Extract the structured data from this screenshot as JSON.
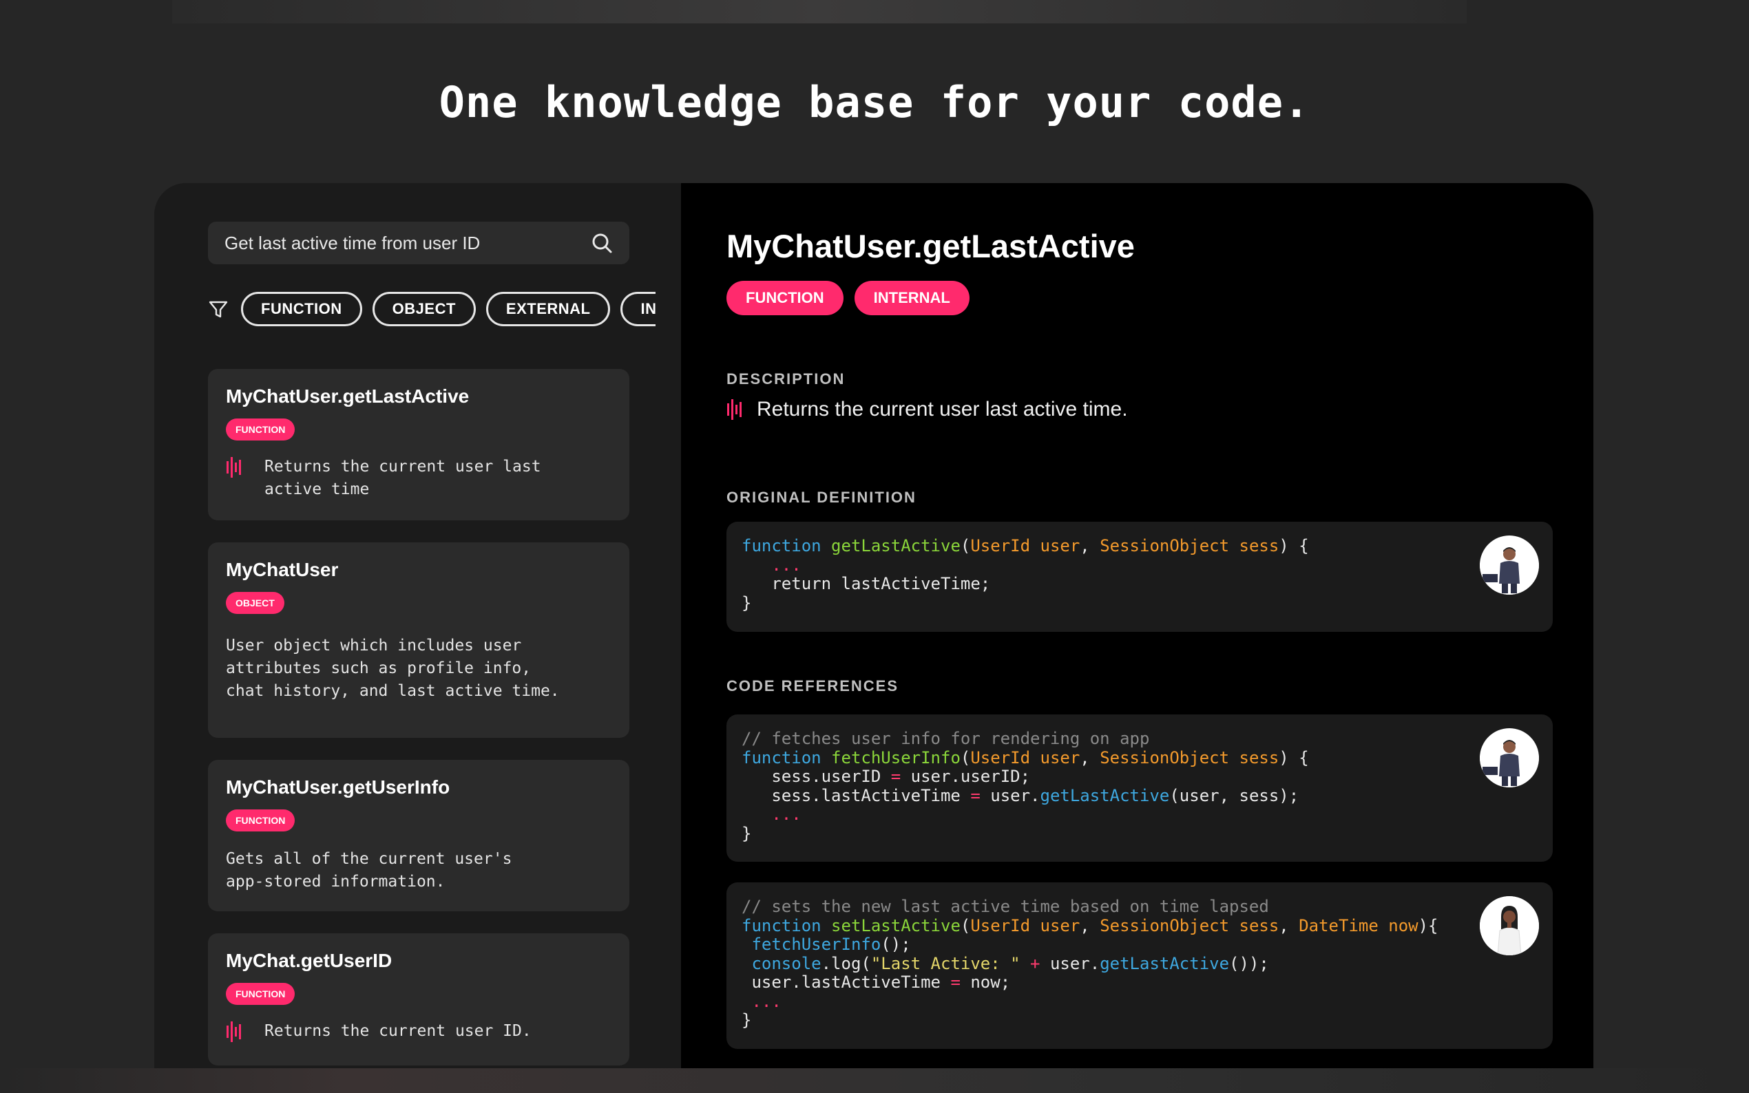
{
  "headline": "One knowledge base for your code.",
  "search": {
    "value": "Get last active time from user ID"
  },
  "filters": [
    "FUNCTION",
    "OBJECT",
    "EXTERNAL",
    "INTERNAL"
  ],
  "results": [
    {
      "title": "MyChatUser.getLastActive",
      "badge": "FUNCTION",
      "desc": "Returns the current user last\nactive time",
      "wave": true
    },
    {
      "title": "MyChatUser",
      "badge": "OBJECT",
      "desc": "User object which includes user\nattributes such as profile info,\nchat history, and last active time.",
      "wave": false
    },
    {
      "title": "MyChatUser.getUserInfo",
      "badge": "FUNCTION",
      "desc": "Gets all of the current user's\napp-stored information.",
      "wave": false
    },
    {
      "title": "MyChat.getUserID",
      "badge": "FUNCTION",
      "desc": "Returns the current user ID.",
      "wave": true
    }
  ],
  "detail": {
    "title": "MyChatUser.getLastActive",
    "badges": [
      "FUNCTION",
      "INTERNAL"
    ],
    "description_label": "DESCRIPTION",
    "description": "Returns the current user last active time.",
    "original_label": "ORIGINAL DEFINITION",
    "references_label": "CODE REFERENCES"
  },
  "code": {
    "definition": [
      [
        [
          "kw",
          "function "
        ],
        [
          "fn",
          "getLastActive"
        ],
        [
          "",
          "("
        ],
        [
          "ty",
          "UserId user"
        ],
        [
          "",
          ", "
        ],
        [
          "ty",
          "SessionObject sess"
        ],
        [
          "",
          ") {"
        ]
      ],
      [
        [
          "pk",
          "   ..."
        ]
      ],
      [
        [
          "",
          "   return lastActiveTime;"
        ]
      ],
      [
        [
          "",
          "}"
        ]
      ]
    ],
    "reference1": [
      [
        [
          "cm",
          "// fetches user info for rendering on app"
        ]
      ],
      [
        [
          "kw",
          "function "
        ],
        [
          "fn",
          "fetchUserInfo"
        ],
        [
          "",
          "("
        ],
        [
          "ty",
          "UserId user"
        ],
        [
          "",
          ", "
        ],
        [
          "ty",
          "SessionObject sess"
        ],
        [
          "",
          ") {"
        ]
      ],
      [
        [
          "",
          "   sess.userID "
        ],
        [
          "pk",
          "="
        ],
        [
          "",
          " user.userID;"
        ]
      ],
      [
        [
          "",
          "   sess.lastActiveTime "
        ],
        [
          "pk",
          "="
        ],
        [
          "",
          " user."
        ],
        [
          "kw",
          "getLastActive"
        ],
        [
          "",
          "(user, sess);"
        ]
      ],
      [
        [
          "pk",
          "   ..."
        ]
      ],
      [
        [
          "",
          "}"
        ]
      ]
    ],
    "reference2": [
      [
        [
          "cm",
          "// sets the new last active time based on time lapsed"
        ]
      ],
      [
        [
          "kw",
          "function "
        ],
        [
          "fn",
          "setLastActive"
        ],
        [
          "",
          "("
        ],
        [
          "ty",
          "UserId user"
        ],
        [
          "",
          ", "
        ],
        [
          "ty",
          "SessionObject sess"
        ],
        [
          "",
          ", "
        ],
        [
          "ty",
          "DateTime now"
        ],
        [
          "",
          "){"
        ]
      ],
      [
        [
          "kw",
          " fetchUserInfo"
        ],
        [
          "",
          "();"
        ]
      ],
      [
        [
          "kw",
          " console"
        ],
        [
          "",
          ".log("
        ],
        [
          "st",
          "\"Last Active: \""
        ],
        [
          "",
          " "
        ],
        [
          "pk",
          "+"
        ],
        [
          "",
          " user."
        ],
        [
          "kw",
          "getLastActive"
        ],
        [
          "",
          "());"
        ]
      ],
      [
        [
          "",
          " user.lastActiveTime "
        ],
        [
          "pk",
          "="
        ],
        [
          "",
          " now;"
        ]
      ],
      [
        [
          "pk",
          " ..."
        ]
      ],
      [
        [
          "",
          "}"
        ]
      ]
    ]
  }
}
